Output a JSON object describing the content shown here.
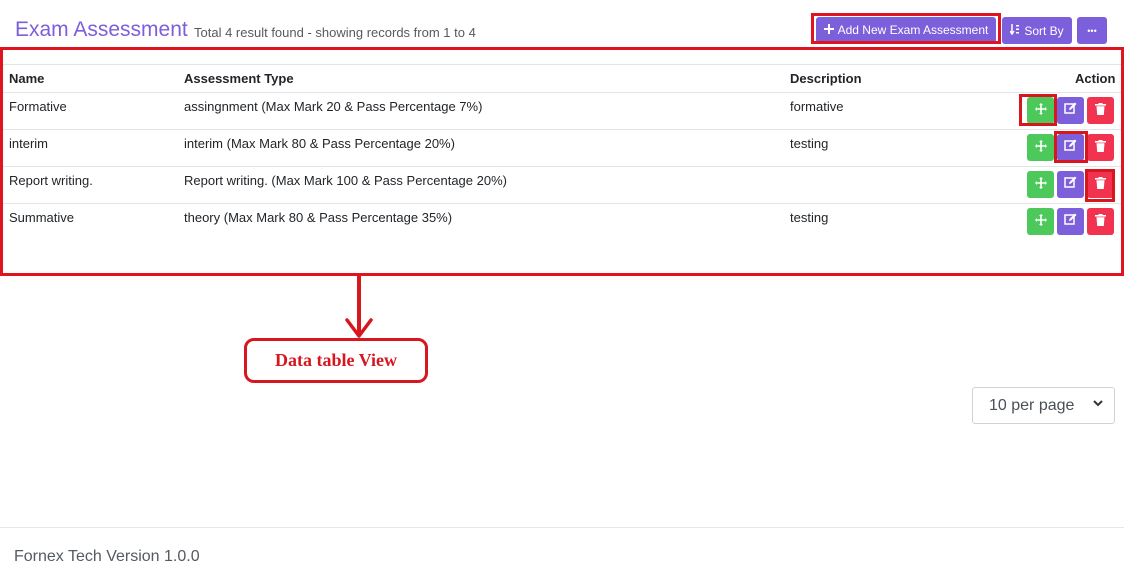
{
  "header": {
    "title": "Exam Assessment",
    "result_info": "Total 4 result found - showing records from 1 to 4",
    "add_button_label": "Add New Exam Assessment",
    "sort_button_label": "Sort By",
    "more_button_label": "•••"
  },
  "table": {
    "columns": [
      "Name",
      "Assessment Type",
      "Description",
      "Action"
    ],
    "rows": [
      {
        "name": "Formative",
        "assessment_type": "assingnment (Max Mark 20 & Pass Percentage 7%)",
        "description": "formative"
      },
      {
        "name": "interim",
        "assessment_type": "interim (Max Mark 80 & Pass Percentage 20%)",
        "description": "testing"
      },
      {
        "name": "Report writing.",
        "assessment_type": "Report writing. (Max Mark 100 & Pass Percentage 20%)",
        "description": ""
      },
      {
        "name": "Summative",
        "assessment_type": "theory (Max Mark 80 & Pass Percentage 35%)",
        "description": "testing"
      }
    ]
  },
  "annotation": {
    "callout_text": "Data table View"
  },
  "pagination": {
    "per_page_selected": "10 per page"
  },
  "footer": {
    "text": "Fornex Tech Version 1.0.0"
  },
  "colors": {
    "brand": "#7b5fdb",
    "move": "#4cc95a",
    "delete": "#f2334f",
    "annotation": "#d7161e"
  },
  "icons": {
    "add": "plus-icon",
    "sort": "sort-icon",
    "more": "ellipsis-icon",
    "move": "move-icon",
    "edit": "edit-icon",
    "delete": "trash-icon"
  }
}
